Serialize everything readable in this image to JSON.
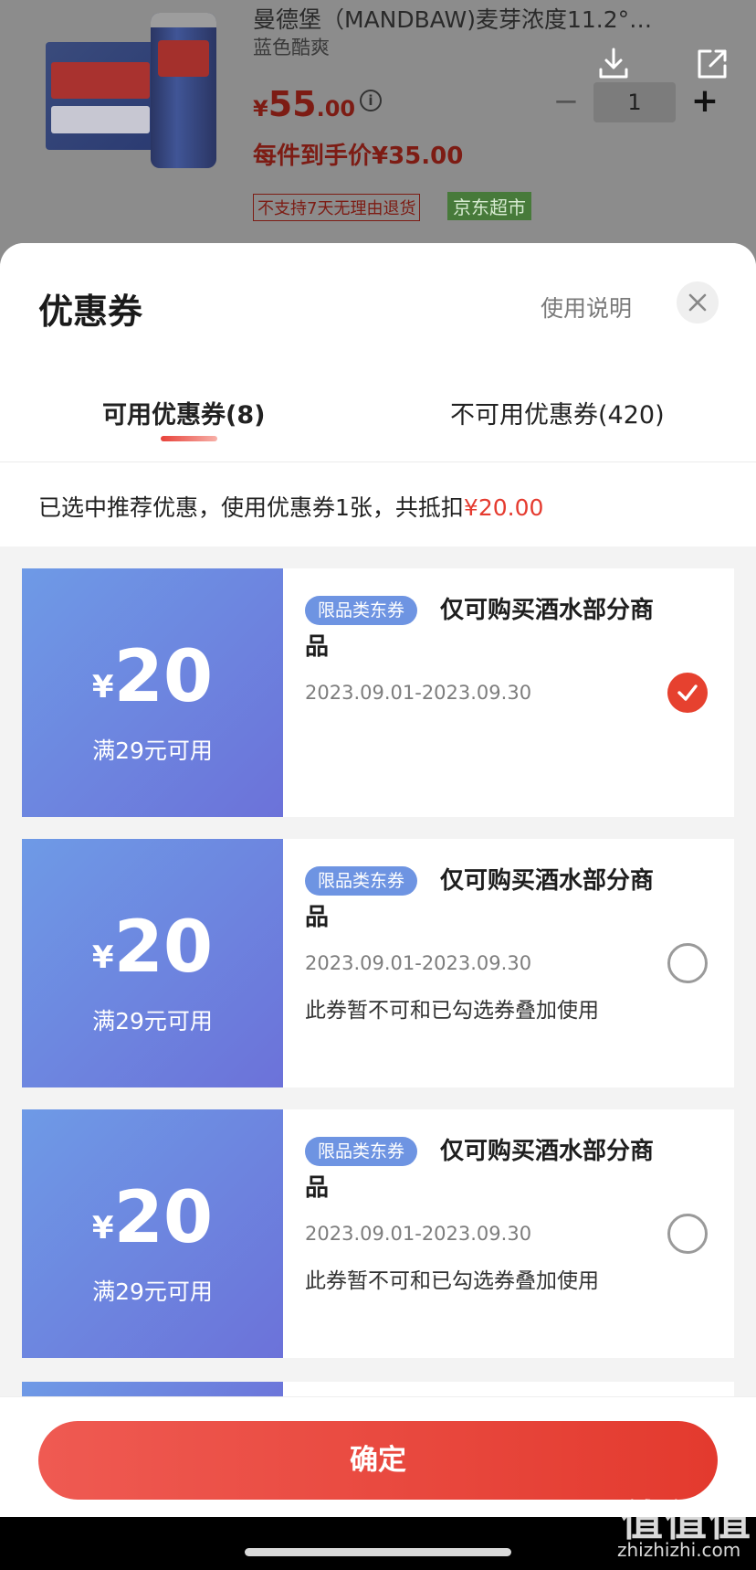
{
  "product": {
    "title": "曼德堡（MANDBAW)麦芽浓度11.2°…",
    "subtitle": "蓝色酷爽",
    "price_symbol": "¥",
    "price_int": "55",
    "price_dec": ".00",
    "final_price": "每件到手价¥35.00",
    "tag_return": "不支持7天无理由退货",
    "tag_store": "京东超市",
    "quantity": "1",
    "minus_label": "−",
    "plus_label": "+"
  },
  "sheet": {
    "title": "优惠券",
    "usage_link": "使用说明",
    "tabs": [
      {
        "label": "可用优惠券(8)",
        "active": true
      },
      {
        "label": "不可用优惠券(420)",
        "active": false
      }
    ],
    "summary_prefix": "已选中推荐优惠，使用优惠券1张，共抵扣",
    "summary_amount": "¥20.00"
  },
  "coupons": [
    {
      "currency": "¥",
      "amount": "20",
      "condition": "满29元可用",
      "tag": "限品类东券",
      "title": "仅可购买酒水部分商品",
      "date_range": "2023.09.01-2023.09.30",
      "note": "",
      "selected": true
    },
    {
      "currency": "¥",
      "amount": "20",
      "condition": "满29元可用",
      "tag": "限品类东券",
      "title": "仅可购买酒水部分商品",
      "date_range": "2023.09.01-2023.09.30",
      "note": "此券暂不可和已勾选券叠加使用",
      "selected": false
    },
    {
      "currency": "¥",
      "amount": "20",
      "condition": "满29元可用",
      "tag": "限品类东券",
      "title": "仅可购买酒水部分商品",
      "date_range": "2023.09.01-2023.09.30",
      "note": "此券暂不可和已勾选券叠加使用",
      "selected": false
    }
  ],
  "confirm_label": "确定",
  "watermark": {
    "logo": "值值值",
    "url": "zhizhizhi.com"
  },
  "colors": {
    "accent_red": "#e53b2f",
    "coupon_blue": "#6e94e2",
    "confirm_red": "#e9473e"
  },
  "icons": [
    "download-icon",
    "share-icon",
    "info-icon",
    "close-icon",
    "check-icon"
  ]
}
